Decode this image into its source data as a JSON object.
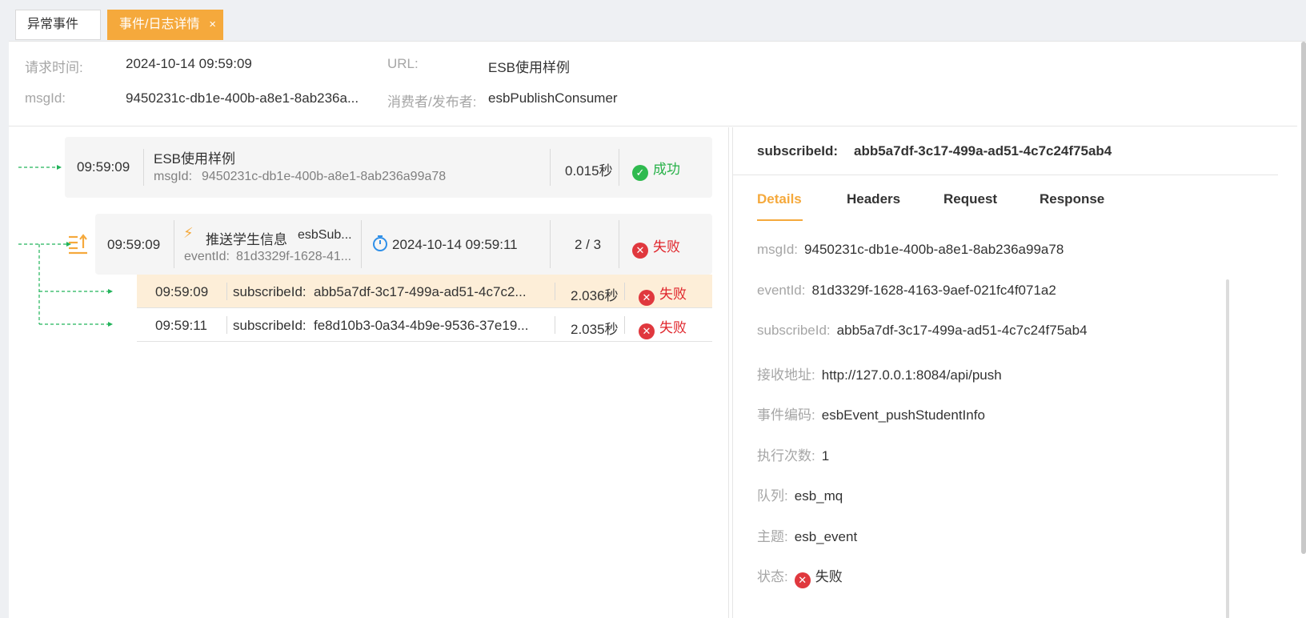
{
  "tabs": [
    {
      "label": "异常事件"
    },
    {
      "label": "事件/日志详情",
      "close": "×"
    }
  ],
  "info": {
    "request_time_label": "请求时间:",
    "request_time": "2024-10-14 09:59:09",
    "url_label": "URL:",
    "url": "ESB使用样例",
    "msgid_label": "msgId:",
    "msgid": "9450231c-db1e-400b-a8e1-8ab236a...",
    "consumer_label": "消费者/发布者:",
    "consumer": "esbPublishConsumer"
  },
  "request_card": {
    "time": "09:59:09",
    "title": "ESB使用样例",
    "msgid_label": "msgId:",
    "msgid": "9450231c-db1e-400b-a8e1-8ab236a99a78",
    "duration": "0.015秒",
    "status": "成功"
  },
  "event_card": {
    "time": "09:59:09",
    "event_name": "推送学生信息",
    "publisher": "esbSub...",
    "eventid_label": "eventId:",
    "eventid": "81d3329f-1628-41...",
    "timestamp": "2024-10-14 09:59:11",
    "count": "2 / 3",
    "status": "失败"
  },
  "subscriptions": [
    {
      "time": "09:59:09",
      "label": "subscribeId:",
      "id": "abb5a7df-3c17-499a-ad51-4c7c2...",
      "duration": "2.036秒",
      "status": "失败"
    },
    {
      "time": "09:59:11",
      "label": "subscribeId:",
      "id": "fe8d10b3-0a34-4b9e-9536-37e19...",
      "duration": "2.035秒",
      "status": "失败"
    }
  ],
  "detail": {
    "header_label": "subscribeId:",
    "header_value": "abb5a7df-3c17-499a-ad51-4c7c24f75ab4",
    "tabs": [
      "Details",
      "Headers",
      "Request",
      "Response"
    ],
    "rows": [
      {
        "k": "msgId:",
        "v": "9450231c-db1e-400b-a8e1-8ab236a99a78"
      },
      {
        "k": "eventId:",
        "v": "81d3329f-1628-4163-9aef-021fc4f071a2"
      },
      {
        "k": "subscribeId:",
        "v": "abb5a7df-3c17-499a-ad51-4c7c24f75ab4"
      },
      {
        "k": "接收地址:",
        "v": "http://127.0.0.1:8084/api/push"
      },
      {
        "k": "事件编码:",
        "v": "esbEvent_pushStudentInfo"
      },
      {
        "k": "执行次数:",
        "v": "1"
      },
      {
        "k": "队列:",
        "v": "esb_mq"
      },
      {
        "k": "主题:",
        "v": "esb_event"
      },
      {
        "k": "状态:",
        "v": "失败"
      }
    ]
  },
  "colors": {
    "accent": "#f5a93c",
    "success": "#27b148",
    "fail": "#e0252b",
    "connector": "#22b35a"
  }
}
